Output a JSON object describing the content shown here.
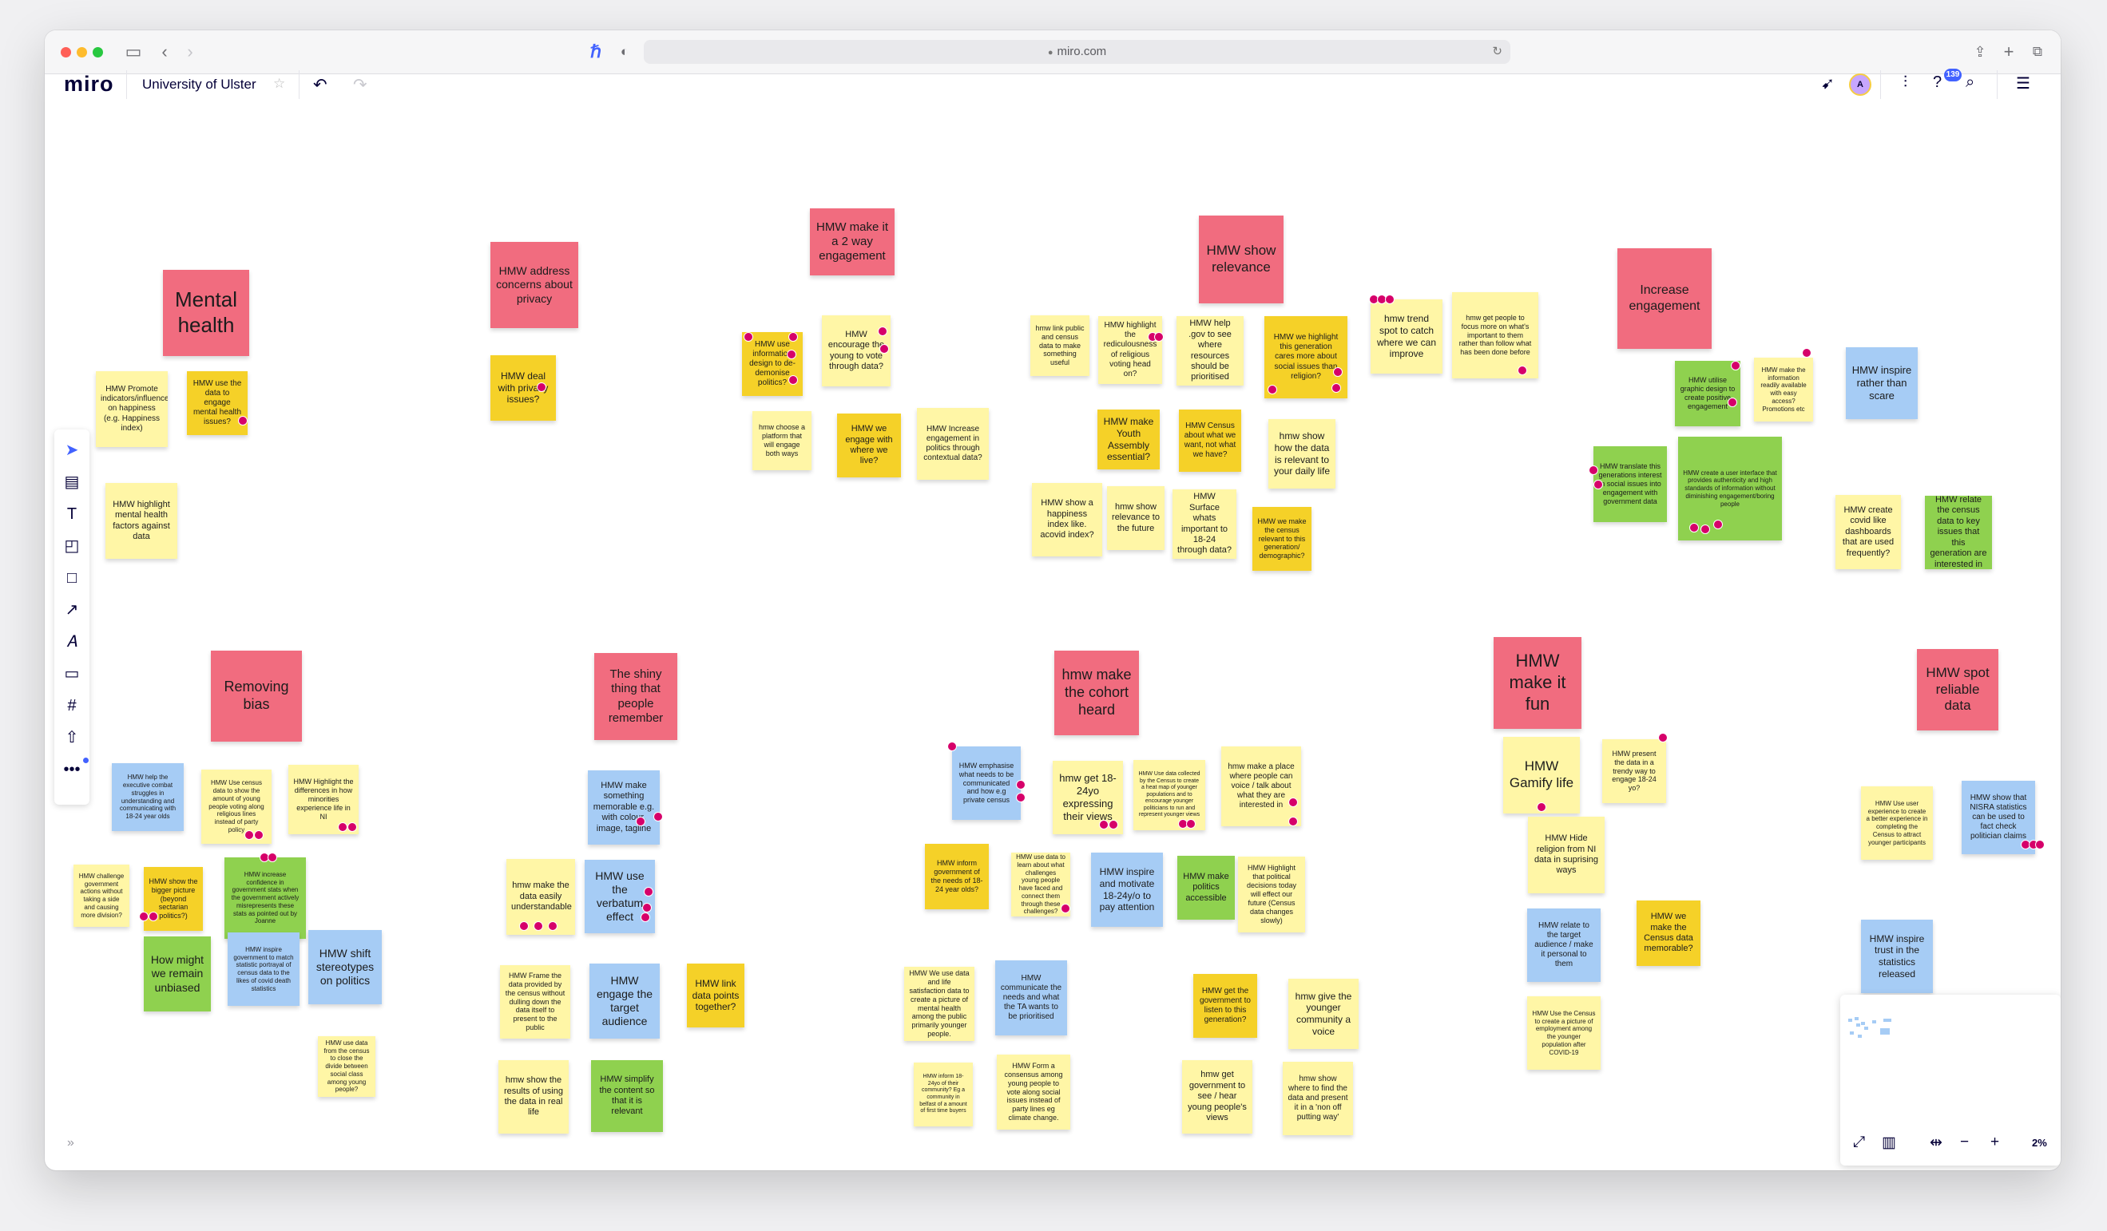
{
  "browser": {
    "url": "miro.com"
  },
  "app": {
    "logo": "miro",
    "board_name": "University of Ulster",
    "notification_count": "139",
    "avatar_initial": "A"
  },
  "zoom": {
    "level": "2%"
  },
  "colors": {
    "yellow": "#fff6a6",
    "gold": "#f5d128",
    "pink": "#f16c7f",
    "blue": "#a6ccf5",
    "green": "#8fd14f",
    "dot": "#d6006a",
    "brand": "#050038"
  },
  "notes": [
    {
      "text": "Mental health",
      "color": "pink"
    },
    {
      "text": "HMW Promote indicators/influences on happiness (e.g. Happiness index)",
      "color": "yellow"
    },
    {
      "text": "HMW use the data to engage mental health issues?",
      "color": "gold"
    },
    {
      "text": "HMW highlight mental health factors against data",
      "color": "yellow"
    },
    {
      "text": "HMW address concerns about privacy",
      "color": "pink"
    },
    {
      "text": "HMW deal with privacy issues?",
      "color": "gold"
    },
    {
      "text": "HMW make it a 2 way engagement",
      "color": "pink"
    },
    {
      "text": "HMW use information design to de-demonise politics?",
      "color": "gold"
    },
    {
      "text": "HMW encourage the young to vote through data?",
      "color": "yellow"
    },
    {
      "text": "hmw choose a platform that will engage both ways",
      "color": "yellow"
    },
    {
      "text": "HMW we engage with where we live?",
      "color": "gold"
    },
    {
      "text": "HMW Increase engagement in politics through contextual data?",
      "color": "yellow"
    },
    {
      "text": "HMW show relevance",
      "color": "pink"
    },
    {
      "text": "hmw link public and census data to make something useful",
      "color": "yellow"
    },
    {
      "text": "HMW highlight the rediculousness of religious voting head on?",
      "color": "yellow"
    },
    {
      "text": "HMW help .gov to see where resources should be prioritised",
      "color": "yellow"
    },
    {
      "text": "HMW we highlight this generation cares more about social issues than religion?",
      "color": "gold"
    },
    {
      "text": "hmw trend spot to catch where we can improve",
      "color": "yellow"
    },
    {
      "text": "hmw get people to focus more on what's important to them rather than follow what has been done before",
      "color": "yellow"
    },
    {
      "text": "HMW make Youth Assembly essential?",
      "color": "gold"
    },
    {
      "text": "HMW Census about what we want, not what we have?",
      "color": "gold"
    },
    {
      "text": "hmw show how the data is relevant to your daily life",
      "color": "yellow"
    },
    {
      "text": "HMW show a happiness index like. acovid index?",
      "color": "yellow"
    },
    {
      "text": "hmw show relevance to the future",
      "color": "yellow"
    },
    {
      "text": "HMW Surface whats important to 18-24 through data?",
      "color": "yellow"
    },
    {
      "text": "HMW we make the census relevant to this generation/ demographic?",
      "color": "gold"
    },
    {
      "text": "Increase engagement",
      "color": "pink"
    },
    {
      "text": "HMW utilise graphic design to create positive engagement",
      "color": "green"
    },
    {
      "text": "HMW make the information readily available with easy access? Promotions etc",
      "color": "yellow"
    },
    {
      "text": "HMW inspire rather than scare",
      "color": "blue"
    },
    {
      "text": "HMW translate this generations interest in social issues into engagement with government data",
      "color": "green"
    },
    {
      "text": "HMW create a user interface that provides authenticity and high standards of information without diminishing engagement/boring people",
      "color": "green"
    },
    {
      "text": "HMW create covid like dashboards that are used frequently?",
      "color": "yellow"
    },
    {
      "text": "HMW relate the census data to key issues that this generation are interested in",
      "color": "green"
    },
    {
      "text": "Removing bias",
      "color": "pink"
    },
    {
      "text": "HMW help the executive combat struggles in understanding and communicating with 18-24 year olds",
      "color": "blue"
    },
    {
      "text": "HMW Use census data to show the amount of young people voting along religious lines instead of party policy",
      "color": "yellow"
    },
    {
      "text": "HMW Highlight the differences in how minorities experience life in NI",
      "color": "yellow"
    },
    {
      "text": "HMW challenge government actions without taking a side and causing more division?",
      "color": "yellow"
    },
    {
      "text": "HMW show the bigger picture (beyond sectarian politics?)",
      "color": "gold"
    },
    {
      "text": "HMW increase confidence in government stats when the government actively misrepresents these stats as pointed out by Joanne",
      "color": "green"
    },
    {
      "text": "How might we remain unbiased",
      "color": "green"
    },
    {
      "text": "HMW inspire government to match statistic portrayal of census data to the likes of covid death statistics",
      "color": "blue"
    },
    {
      "text": "HMW shift stereotypes on politics",
      "color": "blue"
    },
    {
      "text": "HMW use data from the census to close the divide between social class among young people?",
      "color": "yellow"
    },
    {
      "text": "The shiny thing that people remember",
      "color": "pink"
    },
    {
      "text": "HMW make something memorable e.g. with colour, image, tagline",
      "color": "blue"
    },
    {
      "text": "hmw make the data easily understandable",
      "color": "yellow"
    },
    {
      "text": "HMW use the verbatum effect",
      "color": "blue"
    },
    {
      "text": "HMW Frame the data provided by the census without dulling down the data itself to present to the public",
      "color": "yellow"
    },
    {
      "text": "HMW engage the target audience",
      "color": "blue"
    },
    {
      "text": "HMW link data points together?",
      "color": "gold"
    },
    {
      "text": "hmw show the results of using the data in real life",
      "color": "yellow"
    },
    {
      "text": "HMW simplify the content so that it is relevant",
      "color": "green"
    },
    {
      "text": "hmw make the cohort heard",
      "color": "pink"
    },
    {
      "text": "HMW emphasise what needs to be communicated and how e.g private census",
      "color": "blue"
    },
    {
      "text": "hmw get 18-24yo expressing their views",
      "color": "yellow"
    },
    {
      "text": "HMW Use data collected by the Census to create a heat map of younger populations and to encourage younger politicians to run and represent younger views",
      "color": "yellow"
    },
    {
      "text": "hmw make a place where people can voice / talk about what they are interested in",
      "color": "yellow"
    },
    {
      "text": "HMW inform government of the needs of 18-24 year olds?",
      "color": "gold"
    },
    {
      "text": "HMW use data to learn about what challenges young people have faced and connect them through these challenges?",
      "color": "yellow"
    },
    {
      "text": "HMW inspire and motivate 18-24y/o to pay attention",
      "color": "blue"
    },
    {
      "text": "HMW make politics accessible",
      "color": "green"
    },
    {
      "text": "HMW Highlight that political decisions today will effect our future (Census data changes slowly)",
      "color": "yellow"
    },
    {
      "text": "HMW We use data and life satisfaction data to create a picture of mental health among the public primarily younger people.",
      "color": "yellow"
    },
    {
      "text": "HMW communicate the needs and what the TA wants to be prioritised",
      "color": "blue"
    },
    {
      "text": "HMW get the government to listen to this generation?",
      "color": "gold"
    },
    {
      "text": "hmw give the younger community a voice",
      "color": "yellow"
    },
    {
      "text": "HMW inform 18-24yo of their community? Eg a community in belfast of a amount of first time buyers",
      "color": "yellow"
    },
    {
      "text": "HMW Form a consensus among young people to vote along social issues instead of party lines eg climate change.",
      "color": "yellow"
    },
    {
      "text": "hmw get government to see / hear young people's views",
      "color": "yellow"
    },
    {
      "text": "hmw show where to find the data and present it in a 'non off putting way'",
      "color": "yellow"
    },
    {
      "text": "HMW make it fun",
      "color": "pink"
    },
    {
      "text": "HMW Gamify life",
      "color": "yellow"
    },
    {
      "text": "HMW present the data in a trendy way to engage 18-24 yo?",
      "color": "yellow"
    },
    {
      "text": "HMW Hide religion from NI data in suprising ways",
      "color": "yellow"
    },
    {
      "text": "HMW relate to the target audience / make it personal to them",
      "color": "blue"
    },
    {
      "text": "HMW we make the Census data memorable?",
      "color": "gold"
    },
    {
      "text": "HMW Use the Census to create a picture of employment among the younger population after COVID-19",
      "color": "yellow"
    },
    {
      "text": "HMW spot reliable data",
      "color": "pink"
    },
    {
      "text": "HMW Use user experience to create a better experience in completing the Census to attract younger participants",
      "color": "yellow"
    },
    {
      "text": "HMW show that NISRA statistics can be used to fact check politician claims",
      "color": "blue"
    },
    {
      "text": "HMW inspire trust in the statistics released",
      "color": "blue"
    },
    {
      "text": "hmw get",
      "color": "yellow"
    }
  ]
}
